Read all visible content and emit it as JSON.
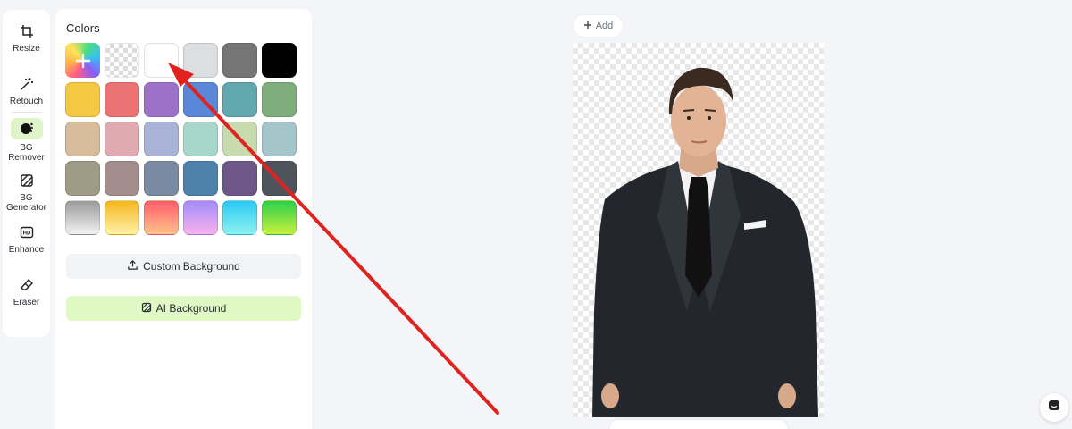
{
  "tools": [
    {
      "label": "Resize",
      "icon": "crop-icon",
      "active": false
    },
    {
      "label": "Retouch",
      "icon": "magic-wand-icon",
      "active": false
    },
    {
      "label": "BG\nRemover",
      "icon": "bg-remover-icon",
      "active": true
    },
    {
      "label": "BG\nGenerator",
      "icon": "bg-generator-icon",
      "active": false
    },
    {
      "label": "Enhance",
      "icon": "hd-icon",
      "active": false
    },
    {
      "label": "Eraser",
      "icon": "eraser-icon",
      "active": false
    }
  ],
  "panel": {
    "title": "Colors",
    "swatches": [
      {
        "type": "plus",
        "color": ""
      },
      {
        "type": "transparent",
        "color": ""
      },
      {
        "type": "solid",
        "color": "#ffffff"
      },
      {
        "type": "solid",
        "color": "#dcdee2"
      },
      {
        "type": "solid",
        "color": "#757575"
      },
      {
        "type": "solid",
        "color": "#000000"
      },
      {
        "type": "solid",
        "color": "#f4c842"
      },
      {
        "type": "solid",
        "color": "#ec7373"
      },
      {
        "type": "solid",
        "color": "#9c72c9"
      },
      {
        "type": "solid",
        "color": "#5b87d9"
      },
      {
        "type": "solid",
        "color": "#63a8ae"
      },
      {
        "type": "solid",
        "color": "#7fae7c"
      },
      {
        "type": "solid",
        "color": "#d8bc9c"
      },
      {
        "type": "solid",
        "color": "#e0abb0"
      },
      {
        "type": "solid",
        "color": "#a9b3d7"
      },
      {
        "type": "solid",
        "color": "#a8d6c9"
      },
      {
        "type": "solid",
        "color": "#c7dbae"
      },
      {
        "type": "solid",
        "color": "#a4c6cb"
      },
      {
        "type": "solid",
        "color": "#9e9b87"
      },
      {
        "type": "solid",
        "color": "#a38d8d"
      },
      {
        "type": "solid",
        "color": "#7a8aa2"
      },
      {
        "type": "solid",
        "color": "#4e82ad"
      },
      {
        "type": "solid",
        "color": "#6e5788"
      },
      {
        "type": "solid",
        "color": "#4f535b"
      },
      {
        "type": "gradient",
        "color": "linear-gradient(180deg,#9a9a9a,#f2f2f2)"
      },
      {
        "type": "gradient",
        "color": "linear-gradient(180deg,#f6b51f,#fff2a6)"
      },
      {
        "type": "gradient",
        "color": "linear-gradient(180deg,#ff5d6c,#ffc38a)"
      },
      {
        "type": "gradient",
        "color": "linear-gradient(180deg,#a38bff,#f7b3ea)"
      },
      {
        "type": "gradient",
        "color": "linear-gradient(180deg,#2cc8f5,#8df3ee)"
      },
      {
        "type": "gradient",
        "color": "linear-gradient(180deg,#2bd04d,#c8f03c)"
      }
    ],
    "custom_bg_label": "Custom Background",
    "ai_bg_label": "AI Background"
  },
  "canvas": {
    "add_label": "Add"
  },
  "colors": {
    "accent_green": "#dff8c4",
    "annotation_red": "#e0231f"
  }
}
